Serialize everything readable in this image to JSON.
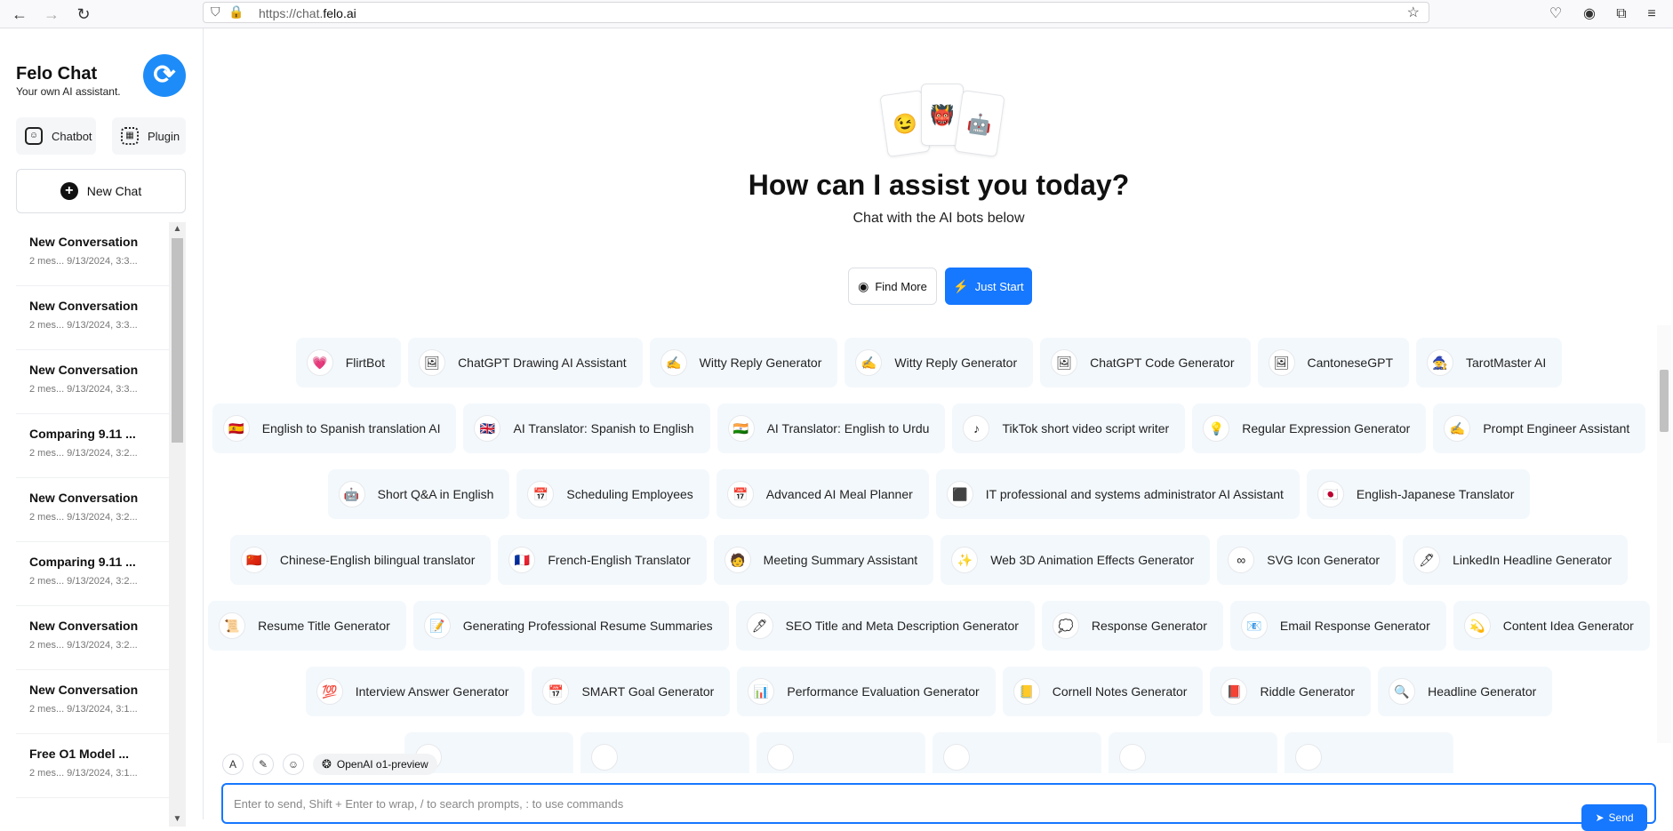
{
  "browser": {
    "url_prefix": "https://chat.",
    "url_domain": "felo.ai"
  },
  "sidebar": {
    "title": "Felo Chat",
    "subtitle": "Your own AI assistant.",
    "tabs": [
      {
        "label": "Chatbot",
        "icon": "chatbot-icon"
      },
      {
        "label": "Plugin",
        "icon": "plugin-icon"
      }
    ],
    "new_chat_label": "New Chat",
    "conversations": [
      {
        "title": "New Conversation",
        "meta": "2 mes...   9/13/2024, 3:3..."
      },
      {
        "title": "New Conversation",
        "meta": "2 mes...   9/13/2024, 3:3..."
      },
      {
        "title": "New Conversation",
        "meta": "2 mes...   9/13/2024, 3:3..."
      },
      {
        "title": "Comparing 9.11 ...",
        "meta": "2 mes...   9/13/2024, 3:2..."
      },
      {
        "title": "New Conversation",
        "meta": "2 mes...   9/13/2024, 3:2..."
      },
      {
        "title": "Comparing 9.11 ...",
        "meta": "2 mes...   9/13/2024, 3:2..."
      },
      {
        "title": "New Conversation",
        "meta": "2 mes...   9/13/2024, 3:2..."
      },
      {
        "title": "New Conversation",
        "meta": "2 mes...   9/13/2024, 3:1..."
      },
      {
        "title": "Free O1 Model ...",
        "meta": "2 mes...   9/13/2024, 3:1..."
      }
    ]
  },
  "hero": {
    "title": "How can I assist you today?",
    "subtitle": "Chat with the AI bots below",
    "find_more_label": "Find More",
    "just_start_label": "Just Start"
  },
  "bot_rows": [
    [
      {
        "label": "FlirtBot",
        "emoji": "💗"
      },
      {
        "label": "ChatGPT Drawing AI Assistant",
        "emoji": "🖼"
      },
      {
        "label": "Witty Reply Generator",
        "emoji": "✍"
      },
      {
        "label": "Witty Reply Generator",
        "emoji": "✍"
      },
      {
        "label": "ChatGPT Code Generator",
        "emoji": "🖼"
      },
      {
        "label": "CantoneseGPT",
        "emoji": "🖼"
      },
      {
        "label": "TarotMaster AI",
        "emoji": "🧙"
      }
    ],
    [
      {
        "label": "English to Spanish translation AI",
        "emoji": "🇪🇸"
      },
      {
        "label": "AI Translator: Spanish to English",
        "emoji": "🇬🇧"
      },
      {
        "label": "AI Translator: English to Urdu",
        "emoji": "🇮🇳"
      },
      {
        "label": "TikTok short video script writer",
        "emoji": "♪"
      },
      {
        "label": "Regular Expression Generator",
        "emoji": "💡"
      },
      {
        "label": "Prompt Engineer Assistant",
        "emoji": "✍"
      }
    ],
    [
      {
        "label": "Short Q&A in English",
        "emoji": "🤖"
      },
      {
        "label": "Scheduling Employees",
        "emoji": "📅"
      },
      {
        "label": "Advanced AI Meal Planner",
        "emoji": "📅"
      },
      {
        "label": "IT professional and systems administrator AI Assistant",
        "emoji": "⬛"
      },
      {
        "label": "English-Japanese Translator",
        "emoji": "🇯🇵"
      }
    ],
    [
      {
        "label": "Chinese-English bilingual translator",
        "emoji": "🇨🇳"
      },
      {
        "label": "French-English Translator",
        "emoji": "🇫🇷"
      },
      {
        "label": "Meeting Summary Assistant",
        "emoji": "🧑"
      },
      {
        "label": "Web 3D Animation Effects Generator",
        "emoji": "✨"
      },
      {
        "label": "SVG Icon Generator",
        "emoji": "∞"
      },
      {
        "label": "LinkedIn Headline Generator",
        "emoji": "🖊"
      }
    ],
    [
      {
        "label": "Resume Title Generator",
        "emoji": "📜"
      },
      {
        "label": "Generating Professional Resume Summaries",
        "emoji": "📝"
      },
      {
        "label": "SEO Title and Meta Description Generator",
        "emoji": "🖊"
      },
      {
        "label": "Response Generator",
        "emoji": "💭"
      },
      {
        "label": "Email Response Generator",
        "emoji": "📧"
      },
      {
        "label": "Content Idea Generator",
        "emoji": "💫"
      }
    ],
    [
      {
        "label": "Interview Answer Generator",
        "emoji": "💯"
      },
      {
        "label": "SMART Goal Generator",
        "emoji": "📅"
      },
      {
        "label": "Performance Evaluation Generator",
        "emoji": "📊"
      },
      {
        "label": "Cornell Notes Generator",
        "emoji": "📒"
      },
      {
        "label": "Riddle Generator",
        "emoji": "📕"
      },
      {
        "label": "Headline Generator",
        "emoji": "🔍"
      }
    ],
    [
      {
        "label": "",
        "emoji": ""
      },
      {
        "label": "",
        "emoji": ""
      },
      {
        "label": "",
        "emoji": ""
      },
      {
        "label": "",
        "emoji": ""
      },
      {
        "label": "",
        "emoji": ""
      },
      {
        "label": "",
        "emoji": ""
      }
    ]
  ],
  "composer": {
    "model_label": "OpenAI o1-preview",
    "placeholder": "Enter to send, Shift + Enter to wrap, / to search prompts, : to use commands",
    "send_label": "Send"
  },
  "colors": {
    "accent": "#1677ff",
    "chip_bg": "#f3f8fc"
  }
}
